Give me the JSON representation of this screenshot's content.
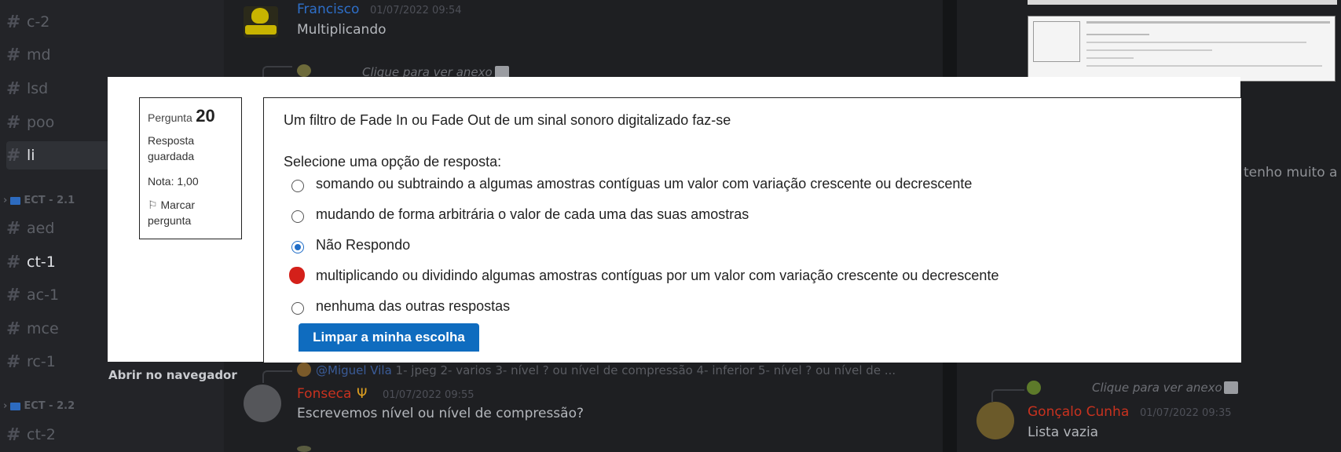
{
  "sidebar": {
    "channels_top": [
      {
        "label": "c-2"
      },
      {
        "label": "md"
      },
      {
        "label": "lsd"
      },
      {
        "label": "poo"
      },
      {
        "label": "li"
      }
    ],
    "category_1": "ECT - 2.1",
    "channels_mid": [
      {
        "label": "aed"
      },
      {
        "label": "ct-1"
      },
      {
        "label": "ac-1"
      },
      {
        "label": "mce"
      },
      {
        "label": "rc-1"
      }
    ],
    "category_2": "ECT - 2.2",
    "channels_bottom": [
      {
        "label": "ct-2"
      }
    ]
  },
  "chat": {
    "msg1": {
      "author": "Francisco",
      "time": "01/07/2022 09:54",
      "text": "Multiplicando",
      "author_color": "#2e6fc9"
    },
    "attach_text": "Clique para ver anexo",
    "reply_preview": {
      "mention": "@Miguel Vila",
      "text": "1- jpeg 2- varios 3- nível ? ou nível de compressão 4- inferior 5- nível ? ou nível de ..."
    },
    "msg2": {
      "author": "Fonseca",
      "time": "01/07/2022 09:55",
      "text": "Escrevemos nível ou nível de compressão?",
      "author_color": "#c9321f"
    }
  },
  "right_panel": {
    "partial_text": "tenho muito a",
    "attach_text": "Clique para ver anexo",
    "msg": {
      "author": "Gonçalo Cunha",
      "time": "01/07/2022 09:35",
      "text": "Lista vazia",
      "author_color": "#c9321f"
    }
  },
  "modal": {
    "info": {
      "question_word": "Pergunta",
      "question_number": "20",
      "status": "Resposta guardada",
      "grade": "Nota: 1,00",
      "flag": "Marcar pergunta"
    },
    "question_text": "Um filtro de Fade In ou Fade Out de um sinal sonoro digitalizado faz-se",
    "prompt": "Selecione uma opção de resposta:",
    "options": [
      {
        "label": "somando ou subtraindo a algumas amostras contíguas um valor com variação crescente ou decrescente",
        "selected": false
      },
      {
        "label": "mudando de forma arbitrária o valor de cada uma das suas amostras",
        "selected": false
      },
      {
        "label": "Não Respondo",
        "selected": true
      },
      {
        "label": "multiplicando ou dividindo algumas amostras contíguas por um valor com variação crescente ou decrescente",
        "selected": false
      },
      {
        "label": "nenhuma das outras respostas",
        "selected": false
      }
    ],
    "clear_button": "Limpar a minha escolha",
    "open_in_browser": "Abrir no navegador"
  }
}
